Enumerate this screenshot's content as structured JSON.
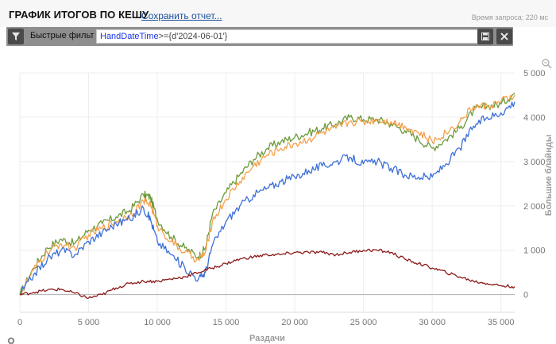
{
  "header": {
    "title": "ГРАФИК ИТОГОВ ПО КЕШУ",
    "save_report": "Сохранить отчет...",
    "query_time": "Время запроса: 220 мс"
  },
  "filter": {
    "label": "Быстрые фильт",
    "query_keyword": "HandDateTime",
    "query_rest": ">={d'2024-06-01'}"
  },
  "icons": {
    "filter": "filter-icon",
    "save": "save-icon",
    "clear": "close-icon",
    "zoom": "zoom-icon",
    "settings": "gear-icon"
  },
  "chart_data": {
    "type": "line",
    "xlabel": "Раздачи",
    "ylabel_right": "Большие блайнды",
    "x_ticks": [
      "0",
      "5 000",
      "10 000",
      "15 000",
      "20 000",
      "25 000",
      "30 000",
      "35 000"
    ],
    "y_ticks": [
      "0",
      "1 000",
      "2 000",
      "3 000",
      "4 000",
      "5 000"
    ],
    "xlim": [
      0,
      36000
    ],
    "ylim": [
      -400,
      5000
    ],
    "grid": true,
    "series": [
      {
        "color": "#6a9a3a",
        "x": [
          0,
          1000,
          2000,
          3000,
          4000,
          5000,
          6000,
          7000,
          8000,
          9000,
          9500,
          10000,
          11000,
          12000,
          13000,
          13500,
          14000,
          15000,
          16000,
          17000,
          18000,
          19000,
          20000,
          21000,
          22000,
          23000,
          24000,
          25000,
          26000,
          27000,
          28000,
          29000,
          30000,
          31000,
          32000,
          33000,
          34000,
          35000,
          36000
        ],
        "y": [
          0,
          600,
          1050,
          1250,
          1150,
          1450,
          1600,
          1750,
          1900,
          2250,
          2200,
          1700,
          1300,
          1050,
          850,
          1050,
          1800,
          2300,
          2700,
          3050,
          3300,
          3450,
          3550,
          3650,
          3750,
          3850,
          4000,
          3950,
          3950,
          3850,
          3700,
          3500,
          3300,
          3500,
          3750,
          4150,
          4250,
          4300,
          4550
        ]
      },
      {
        "color": "#f5a04a",
        "x": [
          0,
          1000,
          2000,
          3000,
          4000,
          5000,
          6000,
          7000,
          8000,
          9000,
          9500,
          10000,
          11000,
          12000,
          13000,
          13500,
          14000,
          15000,
          16000,
          17000,
          18000,
          19000,
          20000,
          21000,
          22000,
          23000,
          24000,
          25000,
          26000,
          27000,
          28000,
          29000,
          30000,
          31000,
          32000,
          33000,
          34000,
          35000,
          36000
        ],
        "y": [
          0,
          550,
          950,
          1150,
          1050,
          1350,
          1500,
          1650,
          1800,
          2100,
          2050,
          1550,
          1200,
          950,
          780,
          950,
          1650,
          2150,
          2550,
          2900,
          3150,
          3300,
          3400,
          3500,
          3650,
          3750,
          3900,
          3900,
          3950,
          3900,
          3800,
          3650,
          3450,
          3650,
          3900,
          4250,
          4250,
          4350,
          4500
        ]
      },
      {
        "color": "#3c6fd8",
        "x": [
          0,
          1000,
          2000,
          3000,
          4000,
          5000,
          6000,
          7000,
          8000,
          9000,
          9500,
          10000,
          11000,
          12000,
          13000,
          13500,
          14000,
          15000,
          16000,
          17000,
          18000,
          19000,
          20000,
          21000,
          22000,
          23000,
          24000,
          25000,
          26000,
          27000,
          28000,
          29000,
          30000,
          31000,
          32000,
          33000,
          34000,
          35000,
          36000
        ],
        "y": [
          0,
          450,
          800,
          1000,
          900,
          1200,
          1400,
          1600,
          1700,
          1950,
          1700,
          1200,
          900,
          600,
          350,
          500,
          1100,
          1650,
          2000,
          2250,
          2400,
          2550,
          2650,
          2800,
          2900,
          3000,
          3100,
          2950,
          3000,
          2850,
          2700,
          2650,
          2650,
          2950,
          3300,
          3800,
          4000,
          4100,
          4350
        ]
      },
      {
        "color": "#8b1a1a",
        "x": [
          0,
          1000,
          2000,
          3000,
          4000,
          5000,
          6000,
          7000,
          8000,
          9000,
          10000,
          11000,
          12000,
          13000,
          14000,
          15000,
          16000,
          17000,
          18000,
          19000,
          20000,
          21000,
          22000,
          23000,
          24000,
          25000,
          26000,
          27000,
          28000,
          29000,
          30000,
          31000,
          32000,
          33000,
          34000,
          35000,
          36000
        ],
        "y": [
          0,
          50,
          100,
          120,
          30,
          -80,
          0,
          150,
          250,
          300,
          300,
          350,
          400,
          500,
          600,
          700,
          800,
          850,
          900,
          900,
          950,
          950,
          950,
          900,
          950,
          1000,
          1000,
          950,
          800,
          700,
          600,
          500,
          400,
          300,
          250,
          200,
          180
        ]
      }
    ]
  }
}
